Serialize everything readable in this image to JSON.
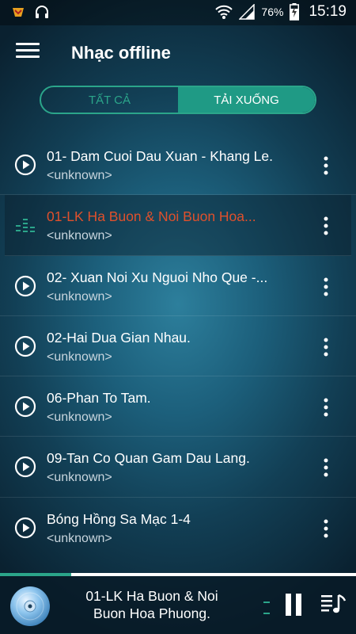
{
  "status_bar": {
    "battery_percent": "76%",
    "time": "15:19"
  },
  "header": {
    "title": "Nhạc offline"
  },
  "tabs": [
    {
      "label": "TẤT CẢ",
      "active": false
    },
    {
      "label": "TẢI XUỐNG",
      "active": true
    }
  ],
  "songs": [
    {
      "title": "01- Dam Cuoi Dau Xuan - Khang Le.",
      "artist": "<unknown>",
      "playing": false
    },
    {
      "title": "01-LK Ha Buon & Noi Buon Hoa...",
      "artist": "<unknown>",
      "playing": true
    },
    {
      "title": "02- Xuan Noi Xu Nguoi Nho Que -...",
      "artist": "<unknown>",
      "playing": false
    },
    {
      "title": "02-Hai Dua Gian Nhau.",
      "artist": "<unknown>",
      "playing": false
    },
    {
      "title": "06-Phan To Tam.",
      "artist": "<unknown>",
      "playing": false
    },
    {
      "title": "09-Tan Co Quan Gam Dau Lang.",
      "artist": "<unknown>",
      "playing": false
    },
    {
      "title": "Bóng Hồng Sa Mạc 1-4",
      "artist": "<unknown>",
      "playing": false
    }
  ],
  "player": {
    "now_playing_line1": "01-LK Ha Buon & Noi",
    "now_playing_line2": "Buon Hoa Phuong.",
    "progress_fraction": 0.2
  },
  "colors": {
    "accent": "#2ba58a",
    "playing_text": "#e0502c"
  }
}
